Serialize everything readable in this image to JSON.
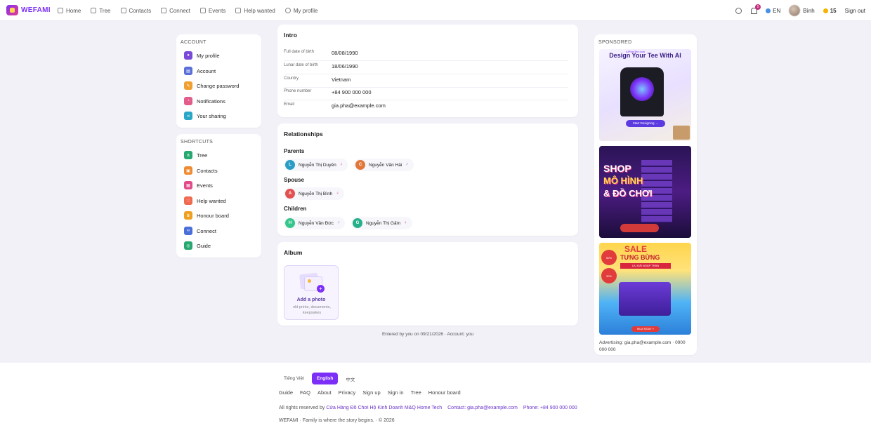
{
  "brand": {
    "name": "WEFAMI"
  },
  "nav": [
    {
      "label": "Home",
      "icon": "home-icon"
    },
    {
      "label": "Tree",
      "icon": "tree-icon"
    },
    {
      "label": "Contacts",
      "icon": "contacts-icon"
    },
    {
      "label": "Connect",
      "icon": "connect-icon"
    },
    {
      "label": "Events",
      "icon": "events-icon"
    },
    {
      "label": "Help wanted",
      "icon": "help-icon"
    },
    {
      "label": "My profile",
      "icon": "user-icon"
    }
  ],
  "topbar": {
    "notifications_count": "5",
    "language": "EN",
    "user_name": "Bình",
    "coins": "15",
    "sign_out": "Sign out"
  },
  "sidebar": {
    "account_heading": "ACCOUNT",
    "account_items": [
      {
        "label": "My profile",
        "color": "#7b4bd8"
      },
      {
        "label": "Account",
        "color": "#5a6fd8"
      },
      {
        "label": "Change password",
        "color": "#f0a030"
      },
      {
        "label": "Notifications",
        "color": "#e25d8a"
      },
      {
        "label": "Your sharing",
        "color": "#2aa6c6"
      }
    ],
    "shortcuts_heading": "SHORTCUTS",
    "shortcut_items": [
      {
        "label": "Tree",
        "color": "#26a870"
      },
      {
        "label": "Contacts",
        "color": "#f08a30"
      },
      {
        "label": "Events",
        "color": "#e24a8a"
      },
      {
        "label": "Help wanted",
        "color": "#f06a50"
      },
      {
        "label": "Honour board",
        "color": "#f0a020"
      },
      {
        "label": "Connect",
        "color": "#4a6fd8"
      },
      {
        "label": "Guide",
        "color": "#26a870"
      }
    ]
  },
  "intro": {
    "title": "Intro",
    "rows": [
      {
        "label": "Full date of birth",
        "value": "08/08/1990"
      },
      {
        "label": "Lunar date of birth",
        "value": "18/06/1990"
      },
      {
        "label": "Country",
        "value": "Vietnam"
      },
      {
        "label": "Phone number",
        "value": "+84 900 000 000"
      },
      {
        "label": "Email",
        "value": "gia.pha@example.com"
      }
    ]
  },
  "relationships": {
    "title": "Relationships",
    "parents_label": "Parents",
    "parents": [
      {
        "initial": "L",
        "name": "Nguyễn Thị Duyên",
        "gender": "♀",
        "color": "#2a9dc6"
      },
      {
        "initial": "C",
        "name": "Nguyễn Văn Hải",
        "gender": "♂",
        "color": "#e2773a"
      }
    ],
    "spouse_label": "Spouse",
    "spouse": [
      {
        "initial": "A",
        "name": "Nguyễn Thị Bình",
        "gender": "♀",
        "color": "#e25050"
      }
    ],
    "children_label": "Children",
    "children": [
      {
        "initial": "H",
        "name": "Nguyễn Văn Đức",
        "gender": "♂",
        "color": "#34c68a"
      },
      {
        "initial": "G",
        "name": "Nguyễn Thị Gấm",
        "gender": "♀",
        "color": "#26b08a"
      }
    ]
  },
  "album": {
    "title": "Album",
    "add_title": "Add a photo",
    "add_sub": "old prints, documents, keepsakes"
  },
  "entered_note": "Entered by you on 09/21/2026 · Account: you",
  "ads": {
    "heading": "SPONSORED",
    "ad1_title": "Design Your Tee With AI",
    "ad1_brand": "AIPrintTee.com",
    "ad1_button": "Start Designing →",
    "ad2_line1": "SHOP",
    "ad2_line2": "MÔ HÌNH",
    "ad2_line3": "& ĐỒ CHƠI",
    "ad3_line1": "SALE",
    "ad3_line2": "TƯNG BỪNG",
    "ad3_ribbon": "ƯU ĐÃI NGẬP TRÀN",
    "ad3_badge1": "50%",
    "ad3_badge2": "30%",
    "ad3_buy": "MUA NGAY »",
    "footer": "Advertising: gia.pha@example.com · 0900 000 000"
  },
  "footer": {
    "languages": [
      {
        "label": "Tiếng Việt",
        "active": false
      },
      {
        "label": "English",
        "active": true
      },
      {
        "label": "中文",
        "active": false
      }
    ],
    "links": [
      "Guide",
      "FAQ",
      "About",
      "Privacy",
      "Sign up",
      "Sign in",
      "Tree",
      "Honour board"
    ],
    "rights_prefix": "All rights reserved by",
    "company": "Cửa Hàng Đồ Chơi Hộ Kinh Doanh M&Q Home Tech",
    "contact": "Contact: gia.pha@example.com",
    "phone": "Phone: +84 900 000 000",
    "tagline": "WEFAMI · Family is where the story begins. · © 2026"
  }
}
